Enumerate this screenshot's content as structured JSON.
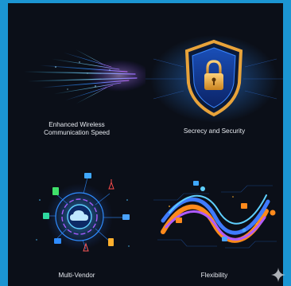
{
  "tiles": [
    {
      "id": "wireless",
      "caption_line1": "Enhanced Wireless",
      "caption_line2": "Communication Speed",
      "illustration": "speed-light-streaks-icon"
    },
    {
      "id": "security",
      "caption_line1": "Secrecy and Security",
      "illustration": "shield-lock-icon"
    },
    {
      "id": "multivendor",
      "caption_line1": "Multi-Vendor",
      "illustration": "cloud-network-hub-icon"
    },
    {
      "id": "flexibility",
      "caption_line1": "Flexibility",
      "illustration": "flowing-waves-network-icon"
    }
  ],
  "colors": {
    "frame": "#1b95d2",
    "panel": "#0b0f18",
    "caption_text": "#e6e9ef",
    "accent_blue": "#2f8cff",
    "accent_purple": "#b05bff",
    "accent_orange": "#ff8a1c",
    "shield_gold": "#e8a33a"
  }
}
